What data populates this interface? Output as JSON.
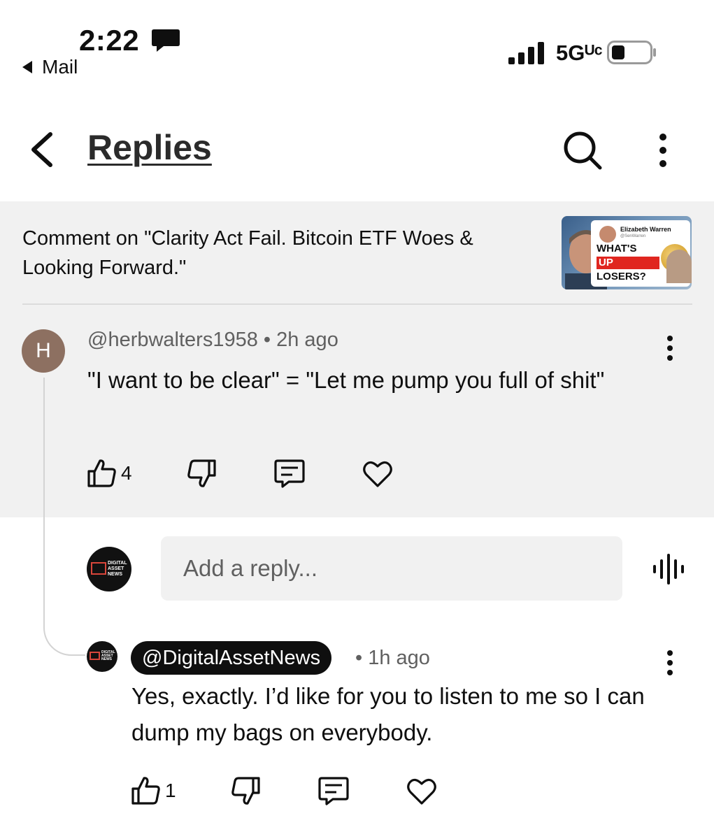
{
  "status_bar": {
    "time": "2:22",
    "back_app": "Mail",
    "network": "5Gᵁᶜ"
  },
  "header": {
    "title": "Replies"
  },
  "context": {
    "text": "Comment on \"Clarity Act Fail. Bitcoin ETF Woes & Looking Forward.\"",
    "thumbnail": {
      "name": "Elizabeth Warren",
      "handle": "@SenWarren",
      "line1": "WHAT'S",
      "line2": "UP",
      "line3": "LOSERS?"
    }
  },
  "comment": {
    "avatar_letter": "H",
    "meta": "@herbwalters1958 • 2h ago",
    "text": "\"I want to be clear\" = \"Let me pump you full of shit\"",
    "likes": "4"
  },
  "reply_box": {
    "placeholder": "Add a reply...",
    "avatar_text": "DIGITAL ASSET NEWS"
  },
  "reply": {
    "author": "@DigitalAssetNews",
    "time": "• 1h ago",
    "text": "Yes, exactly. I’d like for you to listen to me so I can dump my bags on everybody.",
    "likes": "1"
  },
  "colors": {
    "highlight_bg": "#f1f1f1",
    "avatar_h": "#8d7061",
    "pill_bg": "#0f0f0f",
    "secondary_text": "#606060"
  },
  "icons": [
    "chat-bubble-icon",
    "signal-icon",
    "battery-icon",
    "back-arrow-icon",
    "search-icon",
    "more-vert-icon",
    "thumbs-up-icon",
    "thumbs-down-icon",
    "comment-icon",
    "heart-icon",
    "mic-icon"
  ]
}
